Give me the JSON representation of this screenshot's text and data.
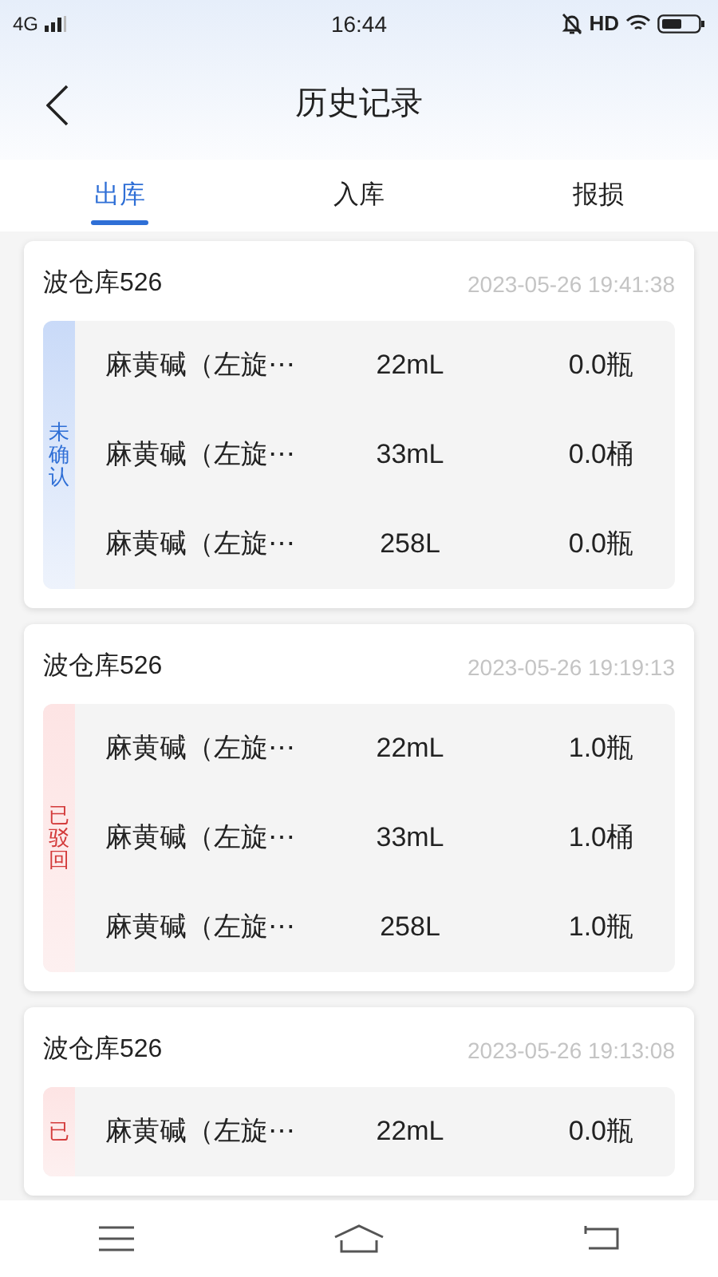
{
  "status_bar": {
    "network": "4G",
    "time": "16:44",
    "hd": "HD"
  },
  "header": {
    "title": "历史记录"
  },
  "tabs": [
    {
      "label": "出库",
      "selected": true
    },
    {
      "label": "入库",
      "selected": false
    },
    {
      "label": "报损",
      "selected": false
    }
  ],
  "records": [
    {
      "warehouse": "波仓库526",
      "time": "2023-05-26 19:41:38",
      "status": {
        "kind": "unconfirmed",
        "label": "未确认"
      },
      "items": [
        {
          "name": "麻黄碱（左旋⋯",
          "amount": "22mL",
          "quantity": "0.0瓶"
        },
        {
          "name": "麻黄碱（左旋⋯",
          "amount": "33mL",
          "quantity": "0.0桶"
        },
        {
          "name": "麻黄碱（左旋⋯",
          "amount": "258L",
          "quantity": "0.0瓶"
        }
      ]
    },
    {
      "warehouse": "波仓库526",
      "time": "2023-05-26 19:19:13",
      "status": {
        "kind": "rejected",
        "label": "已驳回"
      },
      "items": [
        {
          "name": "麻黄碱（左旋⋯",
          "amount": "22mL",
          "quantity": "1.0瓶"
        },
        {
          "name": "麻黄碱（左旋⋯",
          "amount": "33mL",
          "quantity": "1.0桶"
        },
        {
          "name": "麻黄碱（左旋⋯",
          "amount": "258L",
          "quantity": "1.0瓶"
        }
      ]
    },
    {
      "warehouse": "波仓库526",
      "time": "2023-05-26 19:13:08",
      "status": {
        "kind": "rejected",
        "label": "已"
      },
      "items": [
        {
          "name": "麻黄碱（左旋⋯",
          "amount": "22mL",
          "quantity": "0.0瓶"
        }
      ]
    }
  ]
}
